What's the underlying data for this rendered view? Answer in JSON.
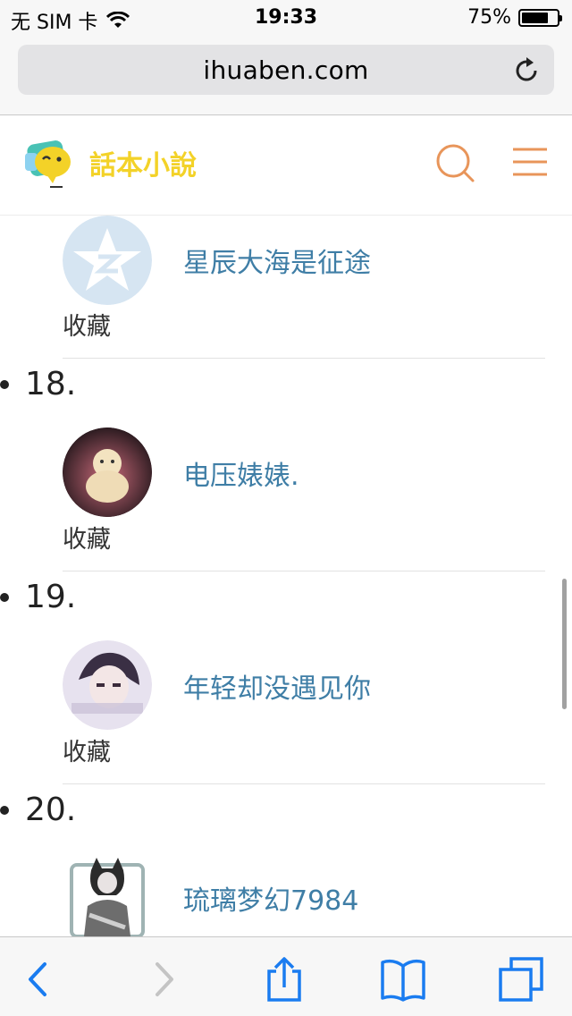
{
  "status_bar": {
    "carrier": "无 SIM 卡",
    "time": "19:33",
    "battery_percent": "75%",
    "battery_level": 0.75
  },
  "browser": {
    "url": "ihuaben.com"
  },
  "site": {
    "logo_text": "話本小說"
  },
  "list": {
    "favorite_label": "收藏",
    "items": [
      {
        "rank": "",
        "author": "星辰大海是征途",
        "avatar": "qq-default-avatar"
      },
      {
        "rank": "18.",
        "author": "电压婊婊.",
        "avatar": "plush-toy-avatar"
      },
      {
        "rank": "19.",
        "author": "年轻却没遇见你",
        "avatar": "girl-photo-avatar"
      },
      {
        "rank": "20.",
        "author": "琉璃梦幻7984",
        "avatar": "anime-character-avatar"
      }
    ]
  },
  "toolbar": {
    "back": "back-icon",
    "forward": "forward-icon",
    "share": "share-icon",
    "bookmarks": "bookmarks-icon",
    "tabs": "tabs-icon"
  },
  "colors": {
    "link": "#3f7ea6",
    "accent_orange": "#e8955a",
    "ios_blue": "#1a7cf0",
    "logo_yellow": "#f3d228"
  }
}
